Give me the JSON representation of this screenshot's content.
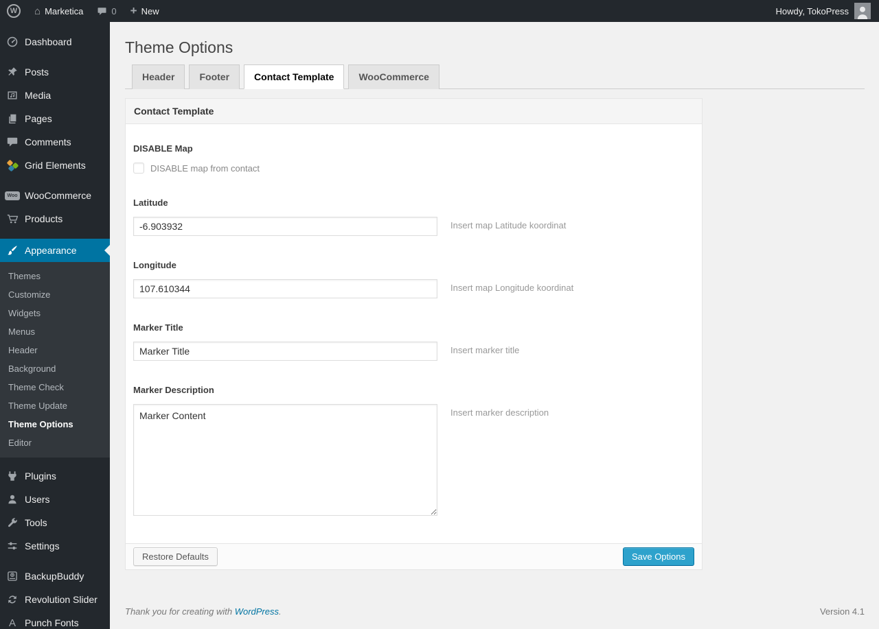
{
  "admin_bar": {
    "site_name": "Marketica",
    "comment_count": "0",
    "new_label": "New",
    "howdy": "Howdy, TokoPress"
  },
  "sidebar": {
    "items": [
      {
        "label": "Dashboard",
        "icon": "dashboard-icon"
      },
      {
        "label": "Posts",
        "icon": "pushpin-icon"
      },
      {
        "label": "Media",
        "icon": "media-icon"
      },
      {
        "label": "Pages",
        "icon": "pages-icon"
      },
      {
        "label": "Comments",
        "icon": "comment-bubble-icon"
      },
      {
        "label": "Grid Elements",
        "icon": "grid-elements-icon"
      },
      {
        "label": "WooCommerce",
        "icon": "woocommerce-badge-icon"
      },
      {
        "label": "Products",
        "icon": "cart-icon"
      },
      {
        "label": "Appearance",
        "icon": "brush-icon",
        "active": true
      },
      {
        "label": "Plugins",
        "icon": "plug-icon"
      },
      {
        "label": "Users",
        "icon": "user-icon"
      },
      {
        "label": "Tools",
        "icon": "wrench-icon"
      },
      {
        "label": "Settings",
        "icon": "sliders-icon"
      },
      {
        "label": "BackupBuddy",
        "icon": "backup-drive-icon"
      },
      {
        "label": "Revolution Slider",
        "icon": "refresh-arrows-icon"
      },
      {
        "label": "Punch Fonts",
        "icon": "letter-a-icon"
      }
    ],
    "appearance_submenu": [
      "Themes",
      "Customize",
      "Widgets",
      "Menus",
      "Header",
      "Background",
      "Theme Check",
      "Theme Update",
      "Theme Options",
      "Editor"
    ],
    "current_submenu_item": "Theme Options"
  },
  "page": {
    "title": "Theme Options",
    "tabs": [
      {
        "label": "Header",
        "active": false
      },
      {
        "label": "Footer",
        "active": false
      },
      {
        "label": "Contact Template",
        "active": true
      },
      {
        "label": "WooCommerce",
        "active": false
      }
    ],
    "panel": {
      "title": "Contact Template",
      "fields": {
        "disable_map": {
          "label": "DISABLE Map",
          "checkbox_label": "DISABLE map from contact",
          "checked": false
        },
        "latitude": {
          "label": "Latitude",
          "value": "-6.903932",
          "help": "Insert map Latitude koordinat"
        },
        "longitude": {
          "label": "Longitude",
          "value": "107.610344",
          "help": "Insert map Longitude koordinat"
        },
        "marker_title": {
          "label": "Marker Title",
          "value": "Marker Title",
          "help": "Insert marker title"
        },
        "marker_description": {
          "label": "Marker Description",
          "value": "Marker Content",
          "help": "Insert marker description"
        }
      },
      "buttons": {
        "restore": "Restore Defaults",
        "save": "Save Options"
      }
    },
    "footer": {
      "thanks_prefix": "Thank you for creating with ",
      "wordpress_link": "WordPress",
      "thanks_suffix": ".",
      "version": "Version 4.1"
    }
  },
  "colors": {
    "admin_dark": "#23282d",
    "submenu_dark": "#32373c",
    "menu_highlight": "#0074a2",
    "primary_button": "#2ea2cc",
    "page_background": "#f1f1f1"
  }
}
